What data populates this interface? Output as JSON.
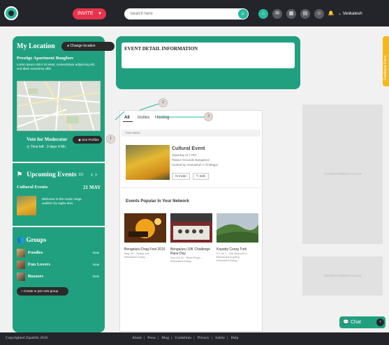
{
  "topbar": {
    "invite_label": "INVITE",
    "search_placeholder": "Search here",
    "user_name": "Venkatesh"
  },
  "location": {
    "title": "My Location",
    "change_label": "Change location",
    "place": "Prestige Apartment Banglore",
    "description": "Lorem ipsum dolor sit amet, consectetuer adipiscing elit, sed diam nonummy nibh",
    "vote_label": "Vote for Moderator",
    "see_profiles_label": "See Profiles",
    "time_left": "Time left : 3 days 4 Mn"
  },
  "upcoming": {
    "title": "Upcoming Events",
    "count": "1/3",
    "event_name": "Cultural Events",
    "event_date": "21 MAY",
    "event_desc": "Welcome to the music mega audition by raghu dixit."
  },
  "groups": {
    "title": "Groups",
    "items": [
      {
        "name": "Foodies",
        "action": "View"
      },
      {
        "name": "Fun Lovers",
        "action": "View"
      },
      {
        "name": "Boozers",
        "action": "View"
      }
    ],
    "create_label": "Create or join new group"
  },
  "event_detail": {
    "title": "EVENT DETAIL INFORMATION"
  },
  "feed": {
    "tabs": [
      "All",
      "Invites",
      "Hosting"
    ],
    "this_week": "THIS WEEK",
    "event": {
      "name": "Cultural Event",
      "time": "Saturday at 7 PM",
      "venue": "Palace Grounds Bangalore",
      "host": "Hosted by Venkatesh V Chittagar",
      "invite_label": "Invite",
      "edit_label": "Edit"
    },
    "popular_title": "Events Popular In Your Network",
    "popular": [
      {
        "name": "Bengaluru Drag Fest 2016",
        "date": "May 29 · Taneja Ind...",
        "actions": "Interested   Going"
      },
      {
        "name": "Bengaluru 10K Challenge Race Day",
        "date": "Sun Jul 10 · Race Road...",
        "actions": "Interested   Going"
      },
      {
        "name": "Kopatty Coorg Trek",
        "date": "Fri Jul 1 · Get Beyond Ll...",
        "sub2": "Bhuvanya is going",
        "actions": "Interested   Going"
      }
    ]
  },
  "ads": {
    "label": "ADVERTISEMENT BLOCK"
  },
  "feedback_label": "Feedback Form",
  "callouts": [
    "1",
    "2",
    "3"
  ],
  "chat_label": "Chat",
  "footer": {
    "copyright": "Copyrighted Zipublik 2016",
    "links": [
      "About",
      "Press",
      "Blog",
      "Guidelines",
      "Privacy",
      "Safety",
      "Help"
    ]
  }
}
